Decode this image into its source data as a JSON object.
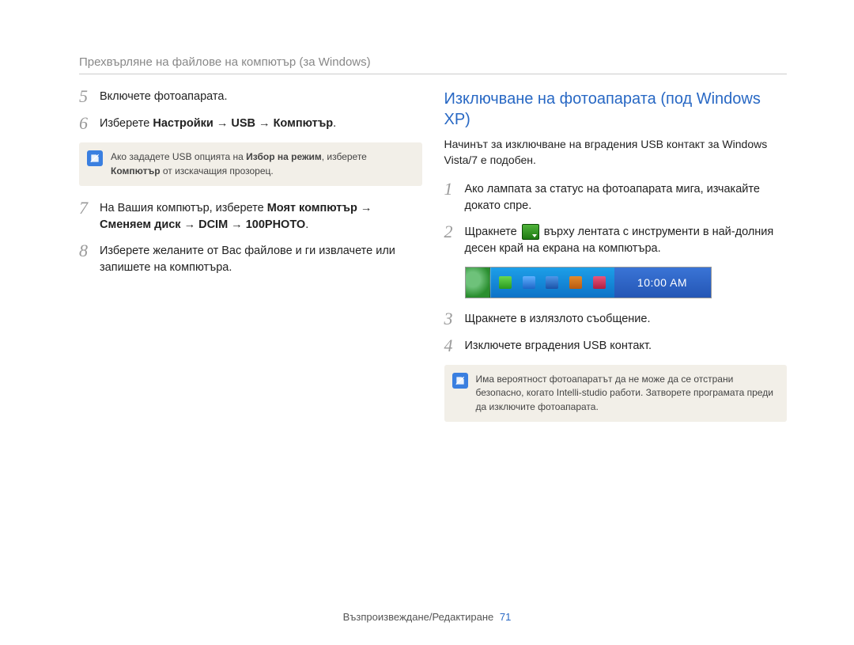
{
  "header": "Прехвърляне на файлове на компютър (за Windows)",
  "left": {
    "steps": {
      "5": {
        "num": "5",
        "text": "Включете фотоапарата."
      },
      "6": {
        "num": "6",
        "prefix": "Изберете ",
        "bold": "Настройки → USB → Компютър",
        "suffix": "."
      },
      "7": {
        "num": "7",
        "prefix": "На Вашия компютър, изберете ",
        "bold": "Моят компютър → Сменяем диск → DCIM → 100PHOTO",
        "suffix": "."
      },
      "8": {
        "num": "8",
        "text": "Изберете желаните от Вас файлове и ги извлачете или запишете на компютъра."
      }
    },
    "note": {
      "prefix": "Ако зададете USB опцията на ",
      "b1": "Избор на режим",
      "mid": ", изберете ",
      "b2": "Компютър",
      "suffix": " от изскачащия прозорец."
    }
  },
  "right": {
    "title": "Изключване на фотоапарата (под Windows XP)",
    "intro": "Начинът за изключване на вградения USB контакт за Windows Vista/7 е подобен.",
    "steps": {
      "1": {
        "num": "1",
        "text": "Ако лампата за статус на фотоапарата мига, изчакайте докато спре."
      },
      "2": {
        "num": "2",
        "pre": "Щракнете ",
        "post": " върху лентата с инструменти в най-долния десен край на екрана на компютъра."
      },
      "3": {
        "num": "3",
        "text": "Щракнете в излязлото съобщение."
      },
      "4": {
        "num": "4",
        "text": "Изключете вградения USB контакт."
      }
    },
    "taskbar_time": "10:00 AM",
    "note": "Има вероятност фотоапаратът да не може да се отстрани безопасно, когато Intelli-studio работи. Затворете програмата преди да изключите фотоапарата."
  },
  "footer": {
    "section": "Възпроизвеждане/Редактиране",
    "page": "71"
  }
}
